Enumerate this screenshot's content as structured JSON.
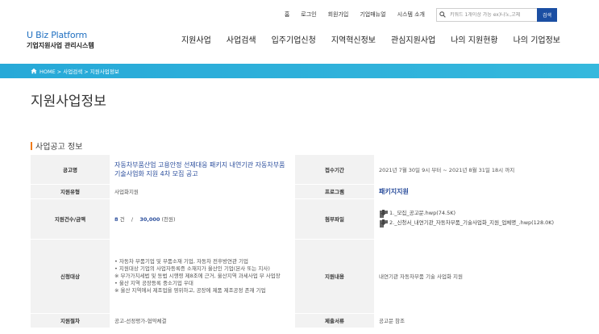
{
  "util": {
    "links": [
      "홈",
      "로그인",
      "회원가입",
      "기업매뉴얼",
      "시스템 소개"
    ],
    "search_placeholder": "키워드 1개이상 가능 ex)나노,고체",
    "search_button": "검색"
  },
  "logo": {
    "line1": "U Biz Platform",
    "line2": "기업지원사업 관리시스템"
  },
  "nav": [
    "지원사업",
    "사업검색",
    "입주기업신청",
    "지역혁신정보",
    "관심지원사업",
    "나의 지원현황",
    "나의 기업정보"
  ],
  "breadcrumb": "HOME > 사업검색 > 지원사업정보",
  "page_title": "지원사업정보",
  "section_title": "사업공고 정보",
  "table": {
    "r1": {
      "label": "공고명",
      "value": "자동차부품산업 고용안정 선제대응 패키지 내연기관 자동차부품 기술사업화 지원 4차 모집 공고",
      "label2": "접수기간",
      "value2": "2021년 7월 30일 9시 부터 ~ 2021년 8월 31일 18시 까지"
    },
    "r2": {
      "label": "지원유형",
      "value": "사업화지원",
      "label2": "프로그램",
      "value2": "패키지지원"
    },
    "r3": {
      "label": "지원건수/금액",
      "count": "8",
      "count_unit": "건",
      "sep": "/",
      "amount": "30,000",
      "amount_unit": "(천원)",
      "label2": "첨부파일",
      "files": [
        "1._모집_공고문.hwp(74.5K)",
        "2._신청서_내연기관_자동차부품_기술사업화_지원_업체명_.hwp(128.0K)"
      ]
    },
    "r4": {
      "label": "신청대상",
      "lines": [
        "• 자동차 부품기업 및 부품소재 기업, 자동차 전후방연관 기업",
        "• 지원대상 기업의 사업자등록증 소재지가 울산인 기업(본사 또는 지사)",
        "※ 부가가치세법 및 동법 시행령 제8조에 근거, 울산지역 과세사업 부 사업장",
        "• 울산 지역 공장등록 중소기업 우대",
        "※ 울산 지역에서 제조업을 영위하고, 공장에 제품 제조공정 존재 기업"
      ],
      "label2": "지원내용",
      "value2": "내연기관 자동차부품 기술 사업화 지원"
    },
    "r5": {
      "label": "지원절차",
      "value": "공고-선정평가-협약체결",
      "label2": "제출서류",
      "value2": "공고문 참조"
    }
  }
}
